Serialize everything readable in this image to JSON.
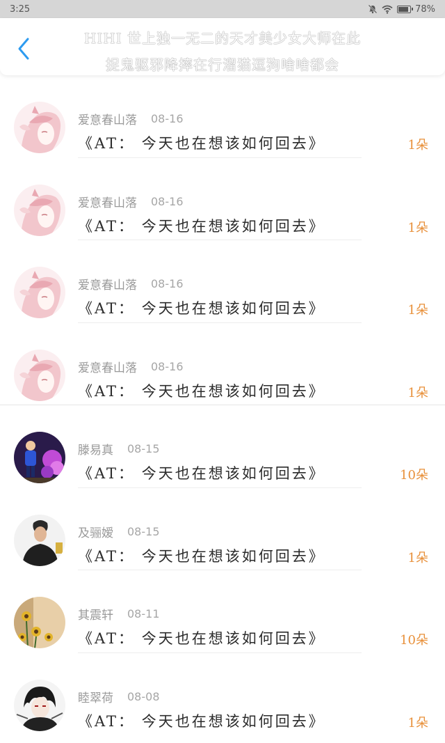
{
  "status_bar": {
    "time": "3:25",
    "battery": "78%",
    "battery_level": 0.78,
    "icons": [
      "mute-icon",
      "wifi-icon",
      "battery-icon"
    ]
  },
  "header": {
    "back_icon": "chevron-left-icon",
    "title_line1": "HIHI 世上独一无二的天才美少女大师在此",
    "title_line2": "捉鬼驱邪降摔在行溜猫逗狗啥啥都会",
    "accent_color": "#2d9bf0"
  },
  "items": [
    {
      "name": "爱意春山落",
      "date": "08-16",
      "message": "《AT： 今天也在想该如何回去》",
      "count": "1朵",
      "avatar": "anime-pink"
    },
    {
      "name": "爱意春山落",
      "date": "08-16",
      "message": "《AT： 今天也在想该如何回去》",
      "count": "1朵",
      "avatar": "anime-pink"
    },
    {
      "name": "爱意春山落",
      "date": "08-16",
      "message": "《AT： 今天也在想该如何回去》",
      "count": "1朵",
      "avatar": "anime-pink"
    },
    {
      "name": "爱意春山落",
      "date": "08-16",
      "message": "《AT： 今天也在想该如何回去》",
      "count": "1朵",
      "avatar": "anime-pink"
    },
    {
      "name": "滕易真",
      "date": "08-15",
      "message": "《AT： 今天也在想该如何回去》",
      "count": "10朵",
      "avatar": "child-purple"
    },
    {
      "name": "及骊嫒",
      "date": "08-15",
      "message": "《AT： 今天也在想该如何回去》",
      "count": "1朵",
      "avatar": "man-dark"
    },
    {
      "name": "其震轩",
      "date": "08-11",
      "message": "《AT： 今天也在想该如何回去》",
      "count": "10朵",
      "avatar": "sunflowers"
    },
    {
      "name": "睦翠荷",
      "date": "08-08",
      "message": "《AT： 今天也在想该如何回去》",
      "count": "1朵",
      "avatar": "anime-dark"
    }
  ],
  "colors": {
    "count": "#e8903a",
    "name": "#9a9a9a",
    "message": "#2c2c2c"
  }
}
